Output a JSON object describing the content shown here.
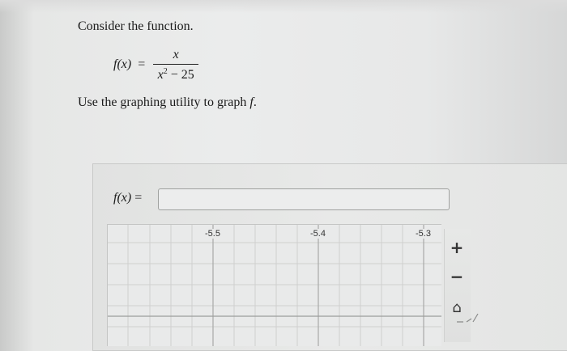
{
  "question": {
    "intro": "Consider the function.",
    "formula": {
      "lhs": "f(x)",
      "equals": "=",
      "numerator": "x",
      "denominator_var": "x",
      "denominator_exp": "2",
      "denominator_rest": " − 25"
    },
    "instruction_prefix": "Use the graphing utility to graph ",
    "instruction_var": "f",
    "instruction_suffix": "."
  },
  "answer": {
    "label": "f(x)",
    "equals": "=",
    "value": "",
    "placeholder": ""
  },
  "graph": {
    "x_tick_labels": [
      "-5.5",
      "-5.4",
      "-5.3"
    ],
    "tools": {
      "zoom_in_icon": "plus-icon",
      "zoom_in_glyph": "+",
      "zoom_out_icon": "minus-icon",
      "zoom_out_glyph": "−",
      "reset_icon": "home-icon",
      "reset_glyph": "⌂"
    }
  }
}
